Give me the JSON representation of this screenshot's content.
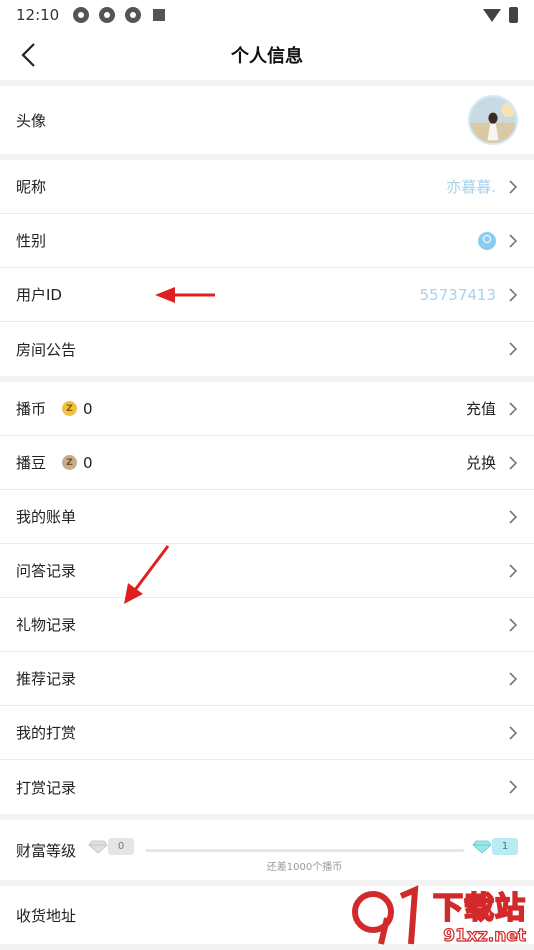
{
  "status_bar": {
    "time": "12:10"
  },
  "header": {
    "title": "个人信息"
  },
  "group1": {
    "avatar_label": "头像"
  },
  "group2": [
    {
      "label": "昵称",
      "value": "亦暮暮."
    },
    {
      "label": "性别",
      "value": ""
    },
    {
      "label": "用户ID",
      "value": "55737413"
    },
    {
      "label": "房间公告",
      "value": ""
    }
  ],
  "group3": {
    "coins": {
      "label": "播币",
      "icon_char": "Z",
      "count": "0",
      "action": "充值"
    },
    "beans": {
      "label": "播豆",
      "icon_char": "Z",
      "count": "0",
      "action": "兑换"
    },
    "items": [
      "我的账单",
      "问答记录",
      "礼物记录",
      "推荐记录",
      "我的打赏",
      "打赏记录"
    ]
  },
  "wealth": {
    "label": "财富等级",
    "current_level": "0",
    "next_level": "1",
    "hint": "还差1000个播币",
    "progress": 0
  },
  "address": {
    "label": "收货地址"
  },
  "watermark": {
    "big": "下载站",
    "small": "91xz.net"
  },
  "colors": {
    "value_blue": "#a9d3ec",
    "annotation_red": "#e02020",
    "coin_gold": "#f2c040"
  },
  "icons": [
    "back-arrow-icon",
    "chevron-right-icon",
    "female-gender-icon",
    "coin-icon",
    "bean-icon",
    "diamond-icon"
  ]
}
